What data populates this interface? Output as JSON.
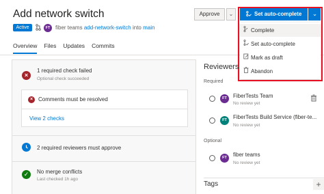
{
  "header": {
    "title": "Add network switch",
    "status": "Active",
    "pr_icon": "pull-request-icon",
    "author_initials": "FT",
    "author": "fiber teams",
    "source_branch": "add-network-switch",
    "into_text": "into",
    "target_branch": "main"
  },
  "tabs": [
    {
      "label": "Overview",
      "active": true
    },
    {
      "label": "Files",
      "active": false
    },
    {
      "label": "Updates",
      "active": false
    },
    {
      "label": "Commits",
      "active": false
    }
  ],
  "toolbar": {
    "approve_label": "Approve",
    "autocomplete_label": "Set auto-complete",
    "accent_color": "#0078d4"
  },
  "dropdown": {
    "items": [
      {
        "label": "Complete",
        "icon": "merge-icon"
      },
      {
        "label": "Set auto-complete",
        "icon": "auto-complete-icon"
      },
      {
        "label": "Mark as draft",
        "icon": "draft-icon"
      },
      {
        "label": "Abandon",
        "icon": "trash-icon"
      }
    ],
    "highlight_color": "#e81123"
  },
  "overview": {
    "checks_failed": "1 required check failed",
    "checks_sub": "Optional check succeeded",
    "comments": "Comments must be resolved",
    "view_checks": "View 2 checks",
    "reviewers_needed": "2 required reviewers must approve",
    "merge_status": "No merge conflicts",
    "merge_sub": "Last checked 1h ago"
  },
  "reviewers": {
    "title": "Reviewers",
    "required_label": "Required",
    "optional_label": "Optional",
    "required": [
      {
        "initials": "FT",
        "name": "FiberTests Team",
        "status": "No review yet",
        "color": "#6b2c91"
      },
      {
        "initials": "FT",
        "name": "FiberTests Build Service (fiber-te...",
        "status": "No review yet",
        "color": "#00827a"
      }
    ],
    "optional": [
      {
        "initials": "FT",
        "name": "fiber teams",
        "status": "No review yet",
        "color": "#6b2c91"
      }
    ]
  },
  "tags": {
    "title": "Tags",
    "add": "+"
  }
}
